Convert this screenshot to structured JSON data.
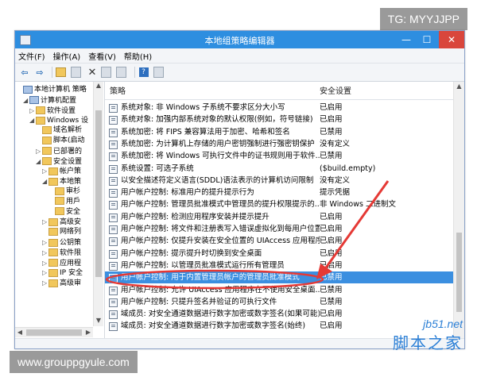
{
  "tags": {
    "top_right": "TG: MYYJJPP",
    "bottom_left": "www.grouppgyule.com"
  },
  "window": {
    "title": "本地组策略编辑器"
  },
  "menu": [
    "文件(F)",
    "操作(A)",
    "查看(V)",
    "帮助(H)"
  ],
  "tree": [
    {
      "label": "本地计算机 策略",
      "indent": 0,
      "icon": "pc",
      "twisty": ""
    },
    {
      "label": "计算机配置",
      "indent": 1,
      "icon": "pc",
      "twisty": "◢"
    },
    {
      "label": "软件设置",
      "indent": 2,
      "icon": "folder",
      "twisty": "▷"
    },
    {
      "label": "Windows 设",
      "indent": 2,
      "icon": "folder",
      "twisty": "◢"
    },
    {
      "label": "域名解析",
      "indent": 3,
      "icon": "folder",
      "twisty": ""
    },
    {
      "label": "脚本(启动",
      "indent": 3,
      "icon": "folder",
      "twisty": ""
    },
    {
      "label": "已部署的",
      "indent": 3,
      "icon": "folder",
      "twisty": "▷"
    },
    {
      "label": "安全设置",
      "indent": 3,
      "icon": "folder",
      "twisty": "◢"
    },
    {
      "label": "帐户策",
      "indent": 4,
      "icon": "folder",
      "twisty": "▷"
    },
    {
      "label": "本地策",
      "indent": 4,
      "icon": "folder",
      "twisty": "◢"
    },
    {
      "label": "审杉",
      "indent": 5,
      "icon": "folder",
      "twisty": ""
    },
    {
      "label": "用戶",
      "indent": 5,
      "icon": "folder",
      "twisty": ""
    },
    {
      "label": "安全",
      "indent": 5,
      "icon": "folder",
      "twisty": ""
    },
    {
      "label": "高级安",
      "indent": 4,
      "icon": "folder",
      "twisty": "▷"
    },
    {
      "label": "网络列",
      "indent": 4,
      "icon": "folder",
      "twisty": ""
    },
    {
      "label": "公钥策",
      "indent": 4,
      "icon": "folder",
      "twisty": "▷"
    },
    {
      "label": "软件限",
      "indent": 4,
      "icon": "folder",
      "twisty": "▷"
    },
    {
      "label": "应用程",
      "indent": 4,
      "icon": "folder",
      "twisty": "▷"
    },
    {
      "label": "IP 安全",
      "indent": 4,
      "icon": "folder",
      "twisty": "▷"
    },
    {
      "label": "高级审",
      "indent": 4,
      "icon": "folder",
      "twisty": "▷"
    }
  ],
  "table": {
    "headers": {
      "policy": "策略",
      "setting": "安全设置"
    },
    "rows": [
      {
        "name": "系统对象: 非 Windows 子系统不要求区分大小写",
        "setting": "已启用"
      },
      {
        "name": "系统对象: 加强内部系统对象的默认权限(例如，符号链接)",
        "setting": "已启用"
      },
      {
        "name": "系统加密: 将 FIPS 兼容算法用于加密、哈希和签名",
        "setting": "已禁用"
      },
      {
        "name": "系统加密: 为计算机上存储的用户密钥强制进行强密钥保护",
        "setting": "没有定义"
      },
      {
        "name": "系统加密: 将 Windows 可执行文件中的证书规则用于软件...",
        "setting": "已禁用"
      },
      {
        "name": "系统设置: 可选子系统",
        "setting": "($build.empty)"
      },
      {
        "name": "以安全描述符定义语言(SDDL)语法表示的计算机访问限制",
        "setting": "没有定义"
      },
      {
        "name": "用户帐户控制: 标准用户的提升提示行为",
        "setting": "提示凭据"
      },
      {
        "name": "用户帐户控制: 管理员批准模式中管理员的提升权限提示的...",
        "setting": "非 Windows 二进制文"
      },
      {
        "name": "用户帐户控制: 检测应用程序安装并提示提升",
        "setting": "已启用"
      },
      {
        "name": "用户帐户控制: 将文件和注册表写入错误虚拟化到每用户位置",
        "setting": "已启用"
      },
      {
        "name": "用户帐户控制: 仅提升安装在安全位置的 UIAccess 应用程序",
        "setting": "已启用"
      },
      {
        "name": "用户帐户控制: 提示提升时切换到安全桌面",
        "setting": "已启用"
      },
      {
        "name": "用户帐户控制: 以管理员批准模式运行所有管理员",
        "setting": "已启用"
      },
      {
        "name": "用户帐户控制: 用于内置管理员帐户的管理员批准模式",
        "setting": "已禁用",
        "selected": true
      },
      {
        "name": "用户帐户控制: 允许 UIAccess 应用程序在不使用安全桌面...",
        "setting": "已禁用"
      },
      {
        "name": "用户帐户控制: 只提升签名并验证的可执行文件",
        "setting": "已禁用"
      },
      {
        "name": "域成员: 对安全通道数据进行数字加密或数字签名(如果可能)",
        "setting": "已启用"
      },
      {
        "name": "域成员: 对安全通道数据进行数字加密或数字签名(始终)",
        "setting": "已启用"
      }
    ]
  },
  "watermark": {
    "site": "jb51.net",
    "brand": "脚本之家"
  },
  "colors": {
    "titlebar": "#2e8ee0",
    "selected_row": "#3b8fe0",
    "annotation": "#e53935"
  }
}
